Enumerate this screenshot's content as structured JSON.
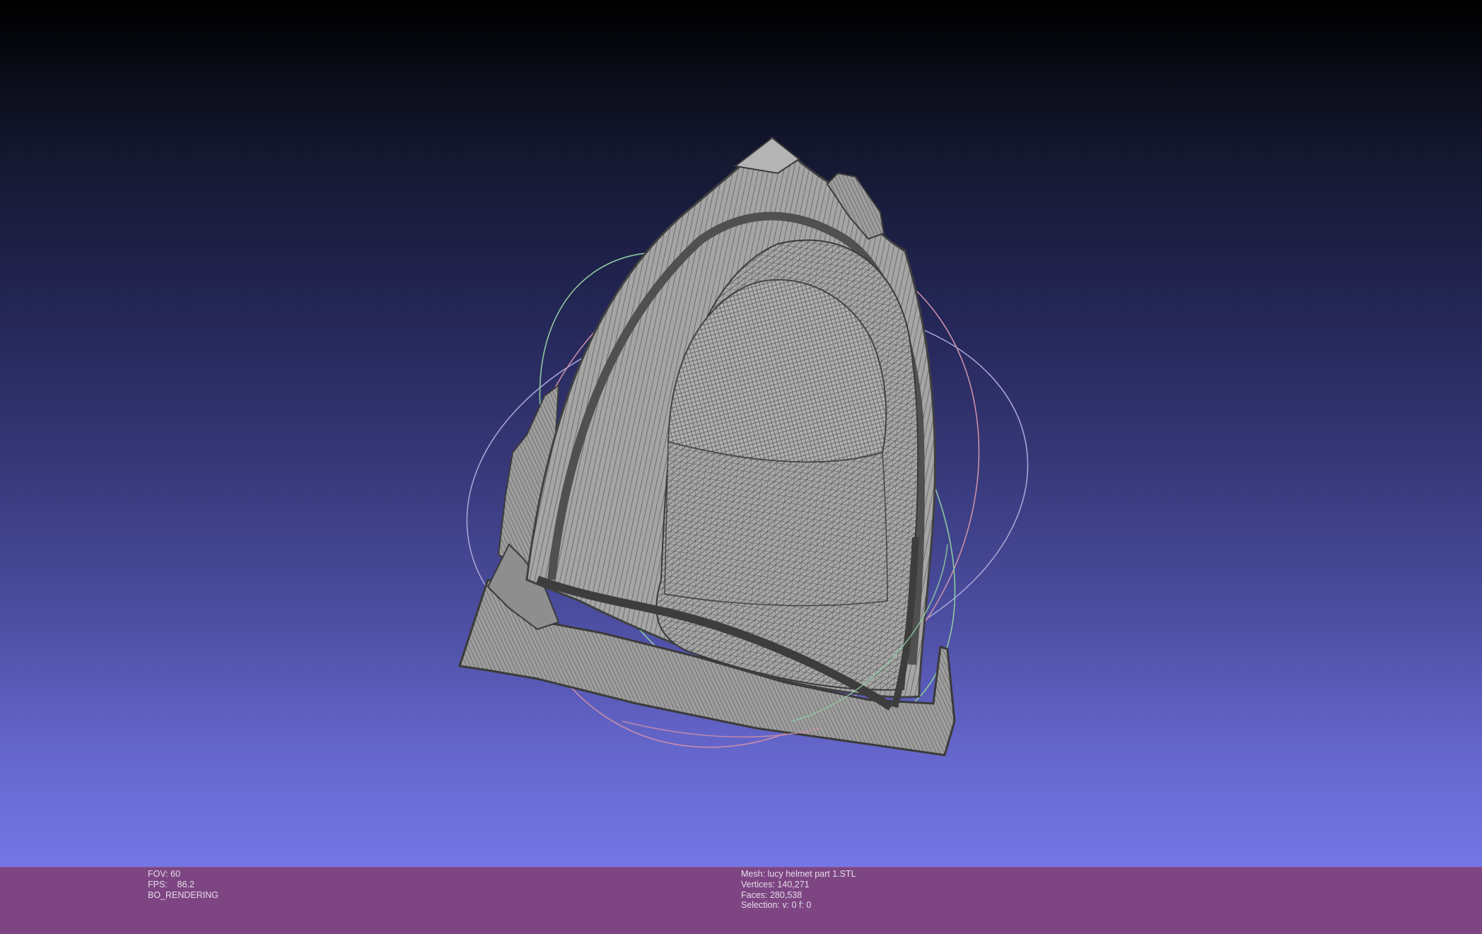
{
  "viewport": {
    "name": "3D mesh viewport",
    "background_gradient": [
      "#000000",
      "#232554",
      "#4a4c9e",
      "#7476e6"
    ],
    "mesh_color": "#9b9b9b",
    "wire_color": "#3c3c3c",
    "trackball_colors": [
      "#c98fa8",
      "#8fc9a0",
      "#a7a4d6"
    ]
  },
  "info_bar": {
    "background": "#7d4683",
    "left": {
      "fov": "FOV: 60",
      "fps": "FPS:    86.2",
      "mode": "BO_RENDERING"
    },
    "right": {
      "mesh": "Mesh: lucy helmet part 1.STL",
      "vertices": "Vertices: 140,271",
      "faces": "Faces: 280,538",
      "selection": "Selection: v: 0 f: 0"
    }
  }
}
